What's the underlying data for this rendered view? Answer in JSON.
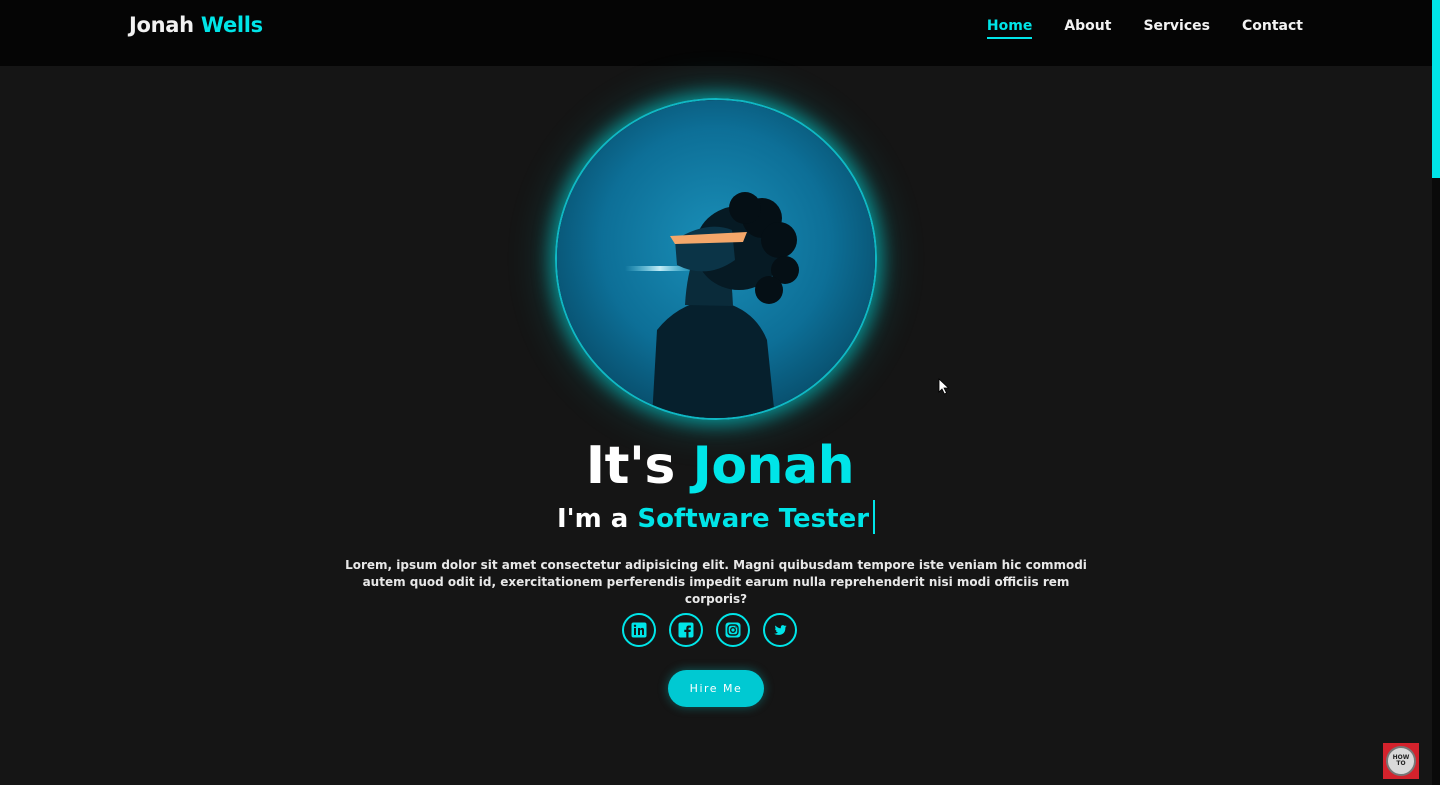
{
  "brand": {
    "first_name": "Jonah",
    "last_name": "Wells"
  },
  "nav": {
    "items": [
      {
        "label": "Home",
        "active": true
      },
      {
        "label": "About",
        "active": false
      },
      {
        "label": "Services",
        "active": false
      },
      {
        "label": "Contact",
        "active": false
      }
    ]
  },
  "hero": {
    "greeting_prefix": "It's",
    "greeting_name": "Jonah",
    "role_prefix": "I'm a",
    "role": "Software Tester",
    "description": "Lorem, ipsum dolor sit amet consectetur adipisicing elit. Magni quibusdam tempore iste veniam hic commodi autem quod odit id, exercitationem perferendis impedit earum nulla reprehenderit nisi modi officiis rem corporis?",
    "hire_button": "Hire Me",
    "socials": [
      "linkedin-icon",
      "facebook-icon",
      "instagram-icon",
      "twitter-icon"
    ]
  },
  "badge": {
    "text": "HOW TO"
  },
  "colors": {
    "accent": "#00e5e8",
    "background": "#151515",
    "header": "#050505",
    "badge": "#d3222c"
  }
}
